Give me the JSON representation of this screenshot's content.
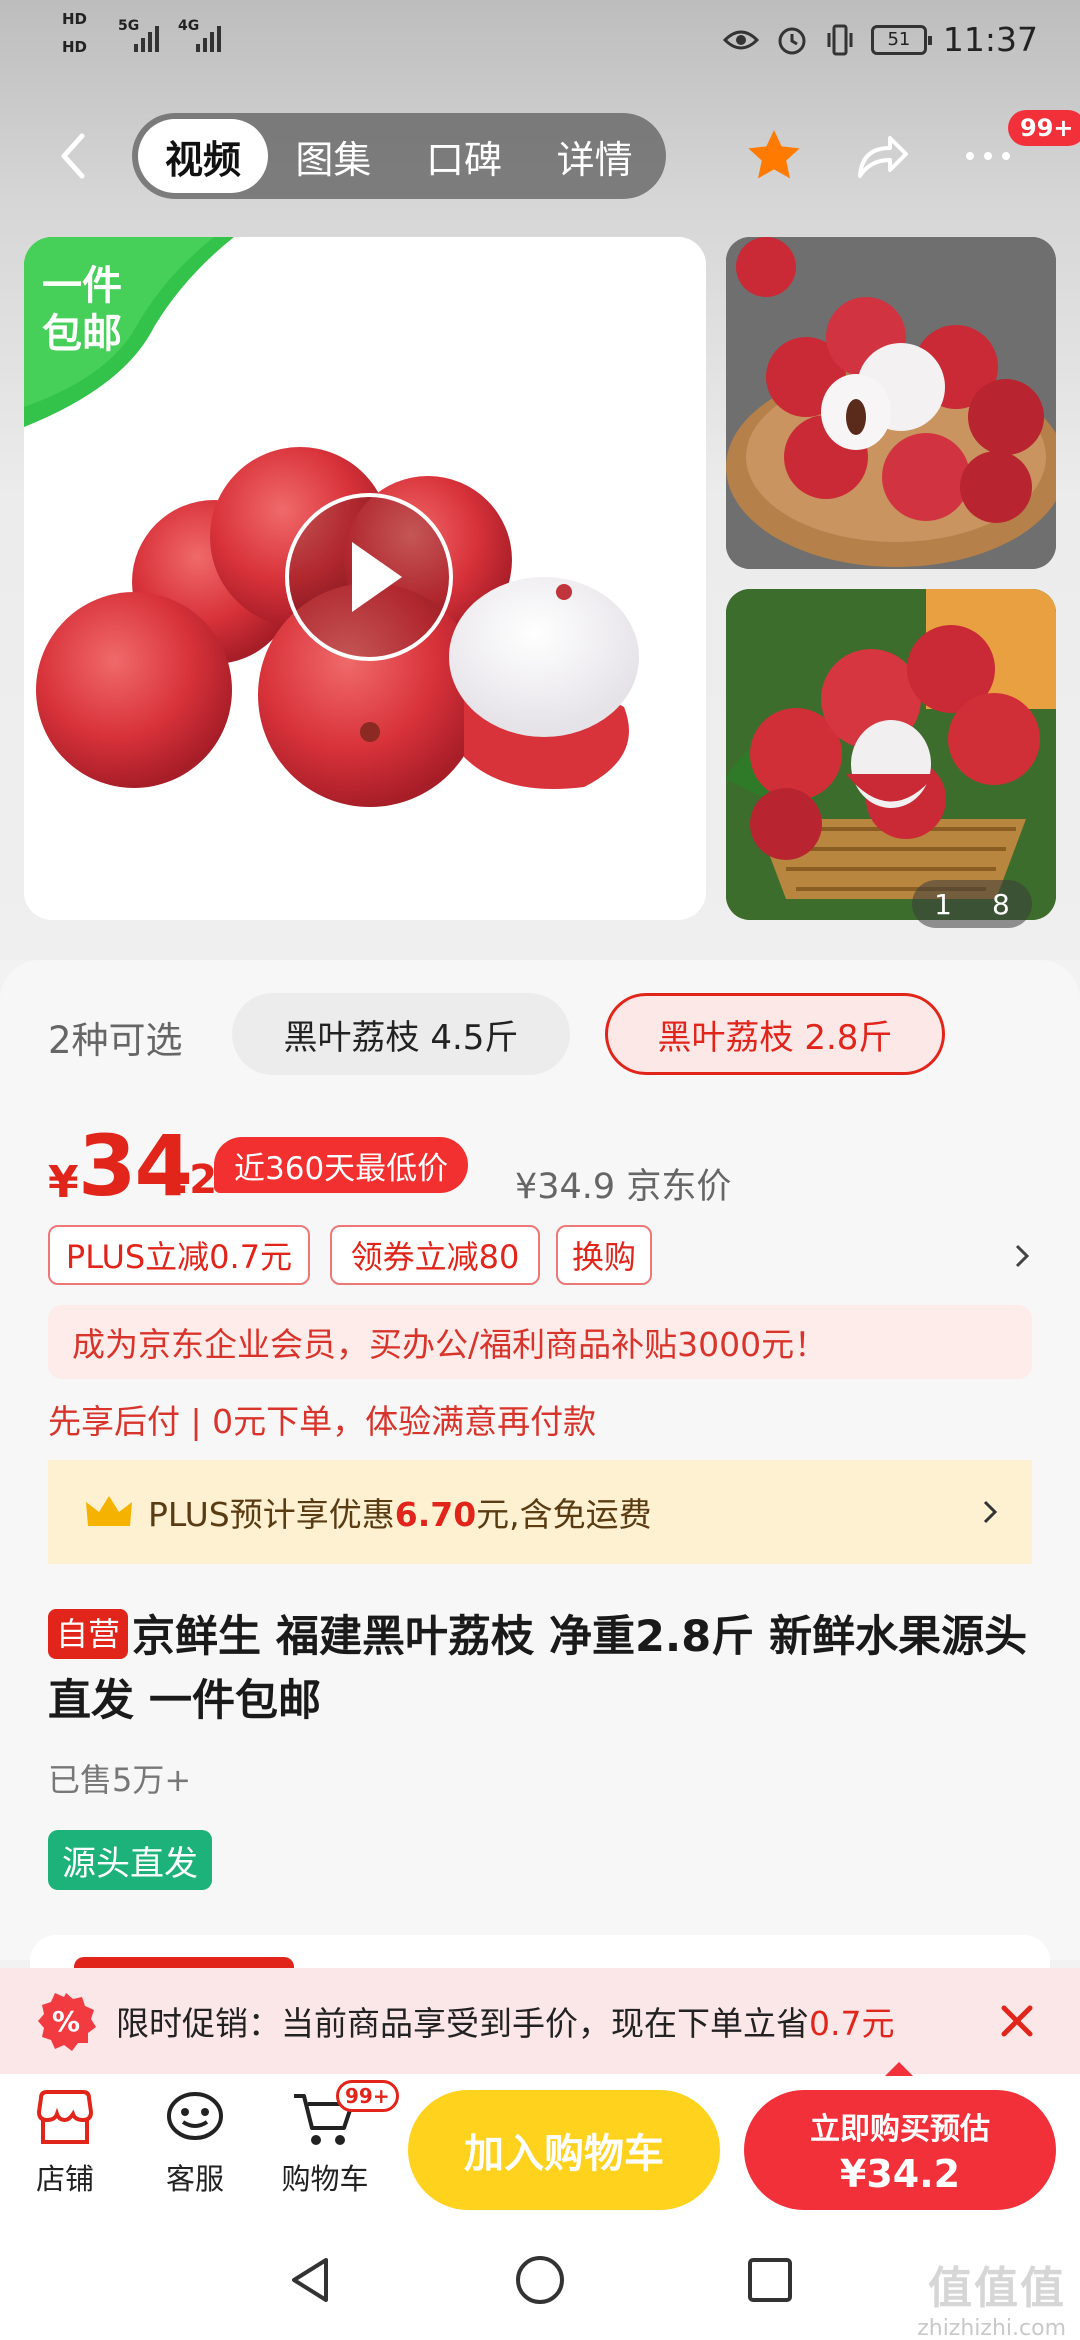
{
  "status_bar": {
    "left_labels": [
      "HD",
      "HD"
    ],
    "network": "5G",
    "network2": "4G",
    "battery": "51",
    "time": "11:37"
  },
  "nav": {
    "tabs": [
      "视频",
      "图集",
      "口碑",
      "详情"
    ],
    "more_badge": "99+"
  },
  "gallery": {
    "badge_text": [
      "一件",
      "包邮"
    ],
    "counter_current": "1",
    "counter_total": "8"
  },
  "options": {
    "label": "2种可选",
    "items": [
      "黑叶荔枝 4.5斤",
      "黑叶荔枝 2.8斤"
    ],
    "selected_index": 1
  },
  "price": {
    "currency": "¥",
    "integer": "34",
    "decimal": ".2",
    "lowest_badge": "近360天最低价",
    "jd_price": "¥34.9 京东价"
  },
  "promo_tags": [
    "PLUS立减0.7元",
    "领券立减80",
    "换购"
  ],
  "enterprise_banner": "成为京东企业会员，买办公/福利商品补贴3000元！",
  "pay_later": "先享后付 | 0元下单，体验满意再付款",
  "plus_bar": {
    "prefix": "PLUS预计享优惠",
    "amount": "6.70",
    "suffix": "元,含免运费"
  },
  "product": {
    "self_tag": "自营",
    "title": "京鲜生 福建黑叶荔枝 净重2.8斤 新鲜水果源头直发 一件包邮",
    "sold": "已售5万+",
    "source_tag": "源头直发"
  },
  "promo_banner": {
    "text": "限时促销：当前商品享受到手价，现在下单立省",
    "amount": "0.7元"
  },
  "bottom_bar": {
    "shop": "店铺",
    "service": "客服",
    "cart": "购物车",
    "cart_badge": "99+",
    "add_to_cart": "加入购物车",
    "buy_line1": "立即购买预估",
    "buy_line2": "¥34.2"
  },
  "watermark": {
    "main": "值值值",
    "sub": "zhizhizhi.com"
  },
  "colors": {
    "brand_red": "#e1251b",
    "buy_red": "#f2303a",
    "cart_yellow": "#ffd21e",
    "source_green": "#1db27a",
    "plus_bg": "#fdf1d2"
  }
}
